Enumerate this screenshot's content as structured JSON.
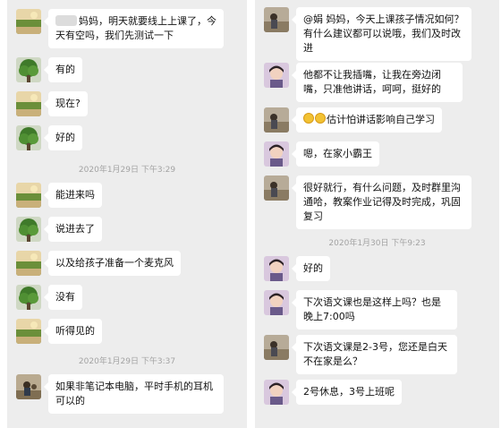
{
  "left": {
    "messages": [
      {
        "text": "妈妈，明天就要线上上课了，今天有空吗，我们先测试一下",
        "redacted_prefix": true
      },
      {
        "text": "有的"
      },
      {
        "text": "现在?"
      },
      {
        "text": "好的"
      }
    ],
    "timestamp_1": "2020年1月29日 下午3:29",
    "messages_2": [
      {
        "text": "能进来吗"
      },
      {
        "text": "说进去了"
      },
      {
        "text": "以及给孩子准备一个麦克风"
      },
      {
        "text": "没有"
      },
      {
        "text": "听得见的"
      }
    ],
    "timestamp_2": "2020年1月29日 下午3:37",
    "message_last": {
      "text": "如果非笔记本电脑，平时手机的耳机可以的"
    }
  },
  "right": {
    "messages": [
      {
        "text": "@娟  妈妈，今天上课孩子情况如何？有什么建议都可以说哦，我们及时改进",
        "mention": "@娟"
      },
      {
        "text": "他都不让我插嘴，让我在旁边闭嘴，只准他讲话，呵呵，挺好的"
      },
      {
        "text": "估计怕讲话影响自己学习",
        "emoji_count": 2
      },
      {
        "text": "嗯，在家小霸王"
      },
      {
        "text": "很好就行，有什么问题，及时群里沟通哈，教案作业记得及时完成，巩固复习"
      }
    ],
    "timestamp": "2020年1月30日 下午9:23",
    "messages_2": [
      {
        "text": "好的"
      },
      {
        "text": "下次语文课也是这样上吗？也是晚上7:00吗"
      },
      {
        "text": "下次语文课是2-3号，您还是白天不在家是么？"
      },
      {
        "text": "2号休息，3号上班呢"
      }
    ]
  },
  "colors": {
    "panel_bg": "#ededed",
    "bubble_bg": "#ffffff",
    "timestamp": "#a3a3a3"
  }
}
